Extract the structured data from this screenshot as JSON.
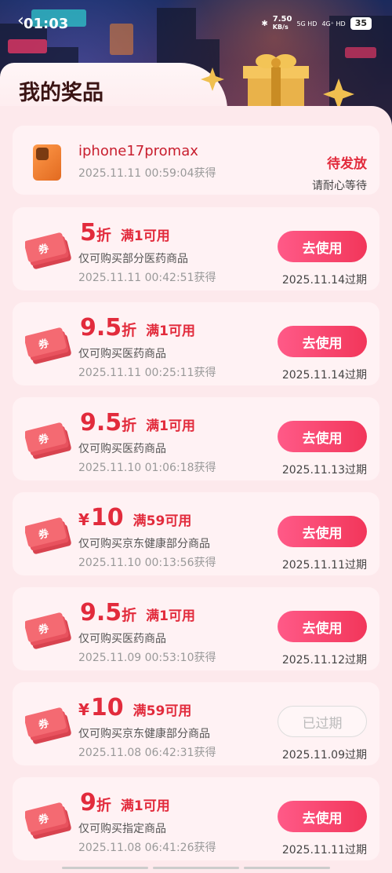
{
  "status": {
    "time": "01:03",
    "network_speed": "7.50",
    "network_unit": "KB/s",
    "sim1": "5G HD",
    "sim2": "4G⁺ HD",
    "battery": "35"
  },
  "page": {
    "title": "我的奖品"
  },
  "prize": {
    "name": "iphone17promax",
    "date": "2025.11.11 00:59:04获得",
    "status": "待发放",
    "note": "请耐心等待"
  },
  "coupons": [
    {
      "prefix": "",
      "value": "5",
      "unit": "折",
      "condition": "满1可用",
      "desc": "仅可购买部分医药商品",
      "date": "2025.11.11 00:42:51获得",
      "button": "去使用",
      "expired": false,
      "expiry": "2025.11.14过期"
    },
    {
      "prefix": "",
      "value": "9.5",
      "unit": "折",
      "condition": "满1可用",
      "desc": "仅可购买医药商品",
      "date": "2025.11.11 00:25:11获得",
      "button": "去使用",
      "expired": false,
      "expiry": "2025.11.14过期"
    },
    {
      "prefix": "",
      "value": "9.5",
      "unit": "折",
      "condition": "满1可用",
      "desc": "仅可购买医药商品",
      "date": "2025.11.10 01:06:18获得",
      "button": "去使用",
      "expired": false,
      "expiry": "2025.11.13过期"
    },
    {
      "prefix": "¥",
      "value": "10",
      "unit": "",
      "condition": "满59可用",
      "desc": "仅可购买京东健康部分商品",
      "date": "2025.11.10 00:13:56获得",
      "button": "去使用",
      "expired": false,
      "expiry": "2025.11.11过期"
    },
    {
      "prefix": "",
      "value": "9.5",
      "unit": "折",
      "condition": "满1可用",
      "desc": "仅可购买医药商品",
      "date": "2025.11.09 00:53:10获得",
      "button": "去使用",
      "expired": false,
      "expiry": "2025.11.12过期"
    },
    {
      "prefix": "¥",
      "value": "10",
      "unit": "",
      "condition": "满59可用",
      "desc": "仅可购买京东健康部分商品",
      "date": "2025.11.08 06:42:31获得",
      "button": "已过期",
      "expired": true,
      "expiry": "2025.11.09过期"
    },
    {
      "prefix": "",
      "value": "9",
      "unit": "折",
      "condition": "满1可用",
      "desc": "仅可购买指定商品",
      "date": "2025.11.08 06:41:26获得",
      "button": "去使用",
      "expired": false,
      "expiry": "2025.11.11过期"
    }
  ],
  "coupon_icon_label": "券",
  "colors": {
    "accent_red": "#e22b3c",
    "button_gradient_start": "#ff5a88",
    "button_gradient_end": "#f2365a",
    "card_bg": "#fff2f4"
  }
}
